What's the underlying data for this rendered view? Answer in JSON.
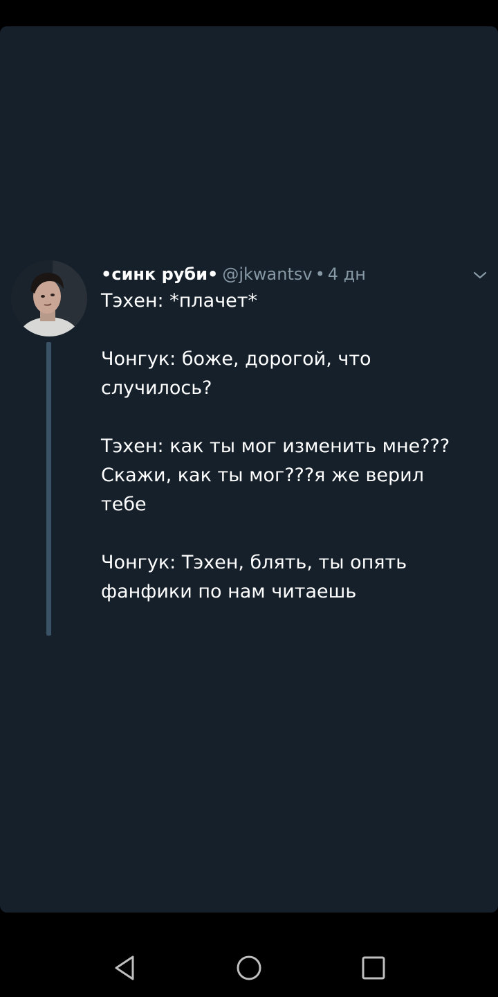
{
  "tweet": {
    "display_name": "•синк руби•",
    "handle": "@jkwantsv",
    "separator": "•",
    "time": "4 дн",
    "paragraphs": [
      "Тэхен: *плачет*",
      "Чонгук: боже, дорогой, что случилось?",
      "Тэхен: как ты мог изменить мне??? Скажи, как ты мог???я же верил тебе",
      "Чонгук: Тэхен, блять, ты опять фанфики по нам читаешь"
    ]
  },
  "icons": {
    "caret": "chevron-down-icon",
    "back": "back-triangle-icon",
    "home": "home-circle-icon",
    "recent": "recent-apps-square-icon"
  },
  "colors": {
    "card_bg": "#15202b",
    "thread_line": "#3a5266",
    "secondary_text": "#8899a6",
    "primary_text": "#ffffff",
    "nav_bg": "#000000"
  }
}
